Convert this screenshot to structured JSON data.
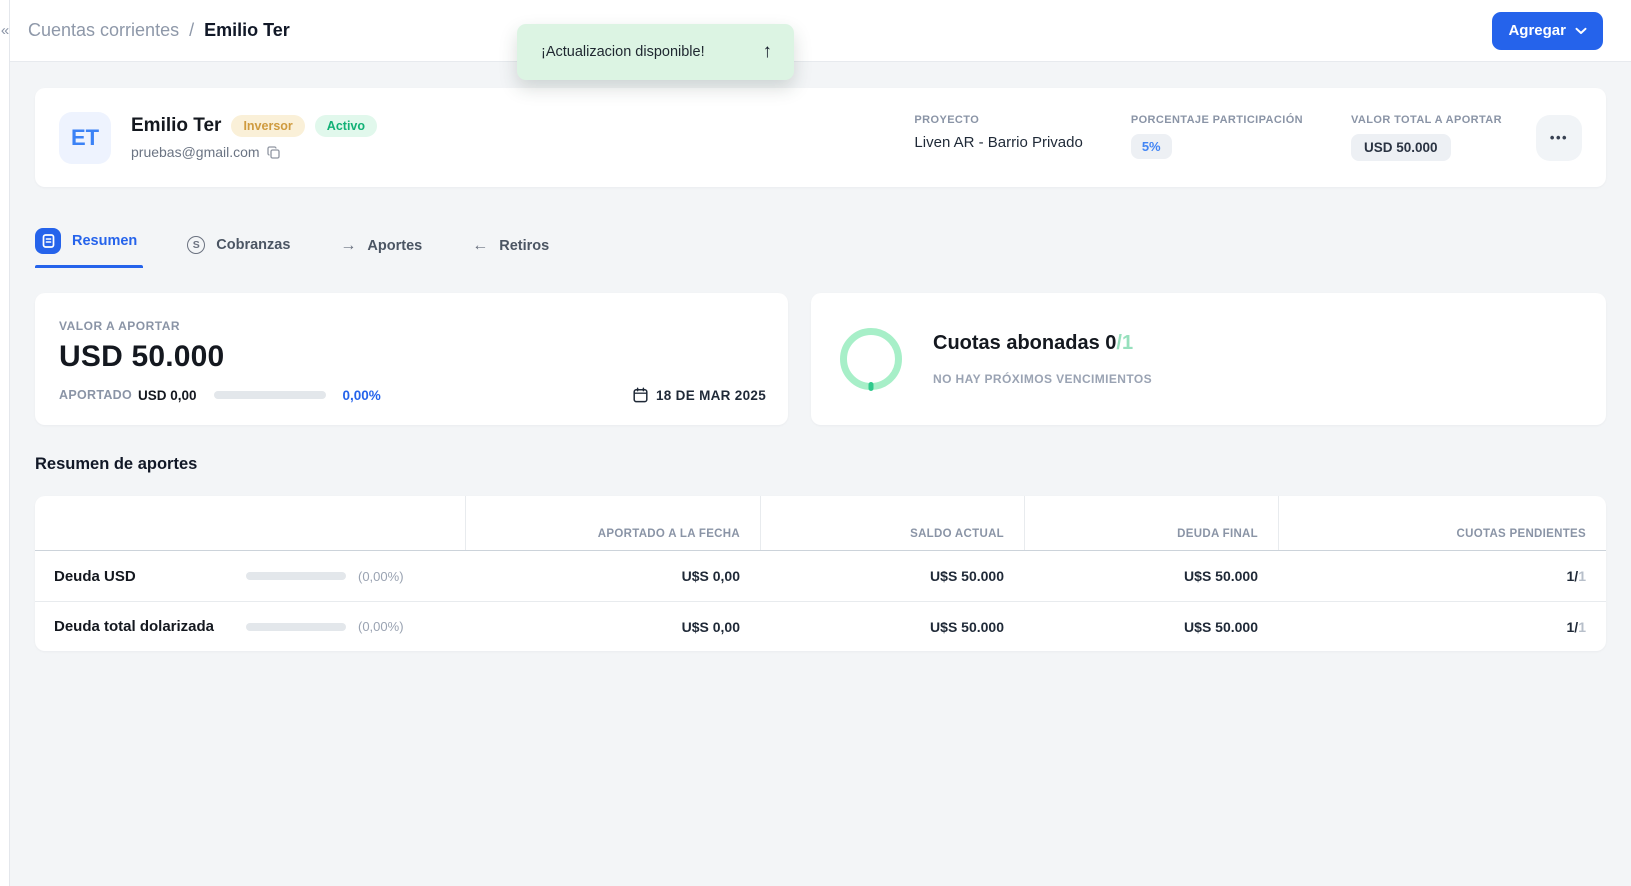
{
  "colors": {
    "accent_blue": "#2563eb",
    "toast_green_bg": "#dcf4e3",
    "badge_yellow_bg": "#faf0d8",
    "badge_yellow_text": "#cf9b3f",
    "badge_green_bg": "#e1f8ec",
    "badge_green_text": "#12b176",
    "donut_ring_green": "#a7efc8",
    "donut_tick_green": "#2fc98c",
    "muted_label_gray": "#8a94a6"
  },
  "topbar": {
    "collapse_icon": "«",
    "breadcrumb": {
      "parent": "Cuentas corrientes",
      "separator": "/",
      "current": "Emilio Ter"
    },
    "agregar_button": "Agregar"
  },
  "toast": {
    "message": "¡Actualizacion disponible!",
    "arrow": "↑"
  },
  "profile": {
    "avatar_initials": "ET",
    "name": "Emilio Ter",
    "role_badge": "Inversor",
    "status_badge": "Activo",
    "email": "pruebas@gmail.com",
    "project_label": "PROYECTO",
    "project_value": "Liven AR - Barrio Privado",
    "participation_label": "PORCENTAJE PARTICIPACIÓN",
    "participation_value": "5%",
    "total_label": "VALOR TOTAL A APORTAR",
    "total_value": "USD 50.000",
    "more_button": "•••"
  },
  "tabs": {
    "resumen": "Resumen",
    "cobranzas": "Cobranzas",
    "aportes": "Aportes",
    "retiros": "Retiros",
    "cobranzas_icon_letter": "S",
    "aportes_icon": "→",
    "retiros_icon": "←"
  },
  "valor_card": {
    "label": "VALOR A APORTAR",
    "amount": "USD 50.000",
    "aportado_label": "APORTADO",
    "aportado_value": "USD 0,00",
    "progress_percent": 0,
    "percent_label": "0,00%",
    "date": "18 DE MAR 2025"
  },
  "cuotas_card": {
    "title_main": "Cuotas abonadas 0",
    "title_suffix": "/1",
    "paid": 0,
    "total": 1,
    "subtitle": "NO HAY PRÓXIMOS VENCIMIENTOS"
  },
  "aportes_table": {
    "section_title": "Resumen de aportes",
    "headers": {
      "aportado": "APORTADO A LA FECHA",
      "saldo": "SALDO ACTUAL",
      "deuda": "DEUDA FINAL",
      "cuotas": "CUOTAS PENDIENTES"
    },
    "rows": [
      {
        "label": "Deuda USD",
        "percent": "(0,00%)",
        "progress_percent": 0,
        "aportado": "U$S 0,00",
        "saldo": "U$S 50.000",
        "deuda": "U$S 50.000",
        "cuotas_done": "1/",
        "cuotas_total": "1"
      },
      {
        "label": "Deuda total dolarizada",
        "percent": "(0,00%)",
        "progress_percent": 0,
        "aportado": "U$S 0,00",
        "saldo": "U$S 50.000",
        "deuda": "U$S 50.000",
        "cuotas_done": "1/",
        "cuotas_total": "1"
      }
    ]
  }
}
